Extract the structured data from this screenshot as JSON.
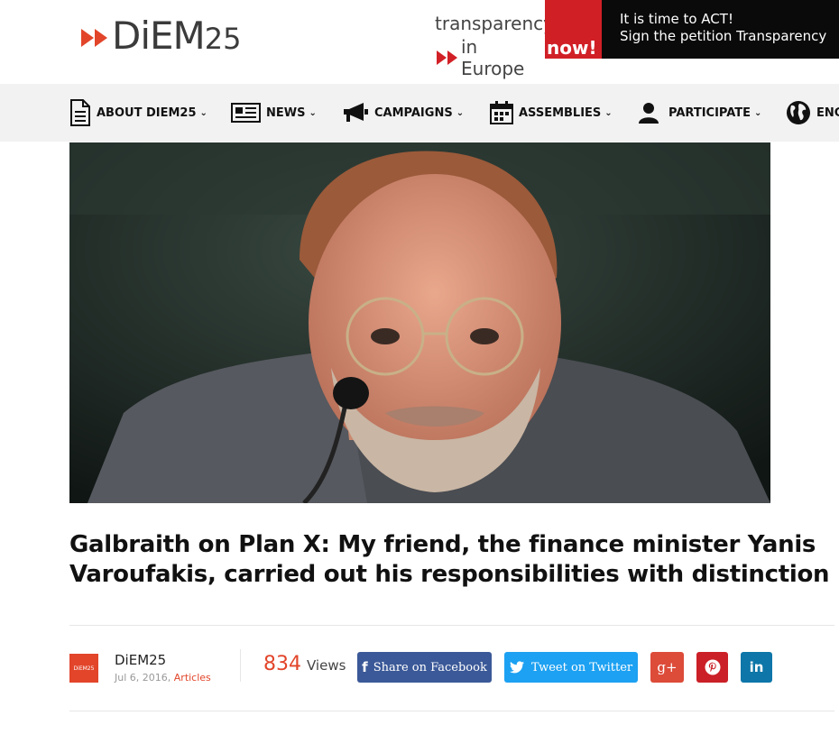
{
  "logo": {
    "main": "DiEM",
    "num": "25"
  },
  "banner": {
    "line1": "transparency",
    "line2": "in Europe",
    "now": "now!",
    "cta1": "It is time to ACT!",
    "cta2": "Sign the petition Transparency"
  },
  "nav": {
    "about": "ABOUT DIEM25",
    "news": "NEWS",
    "campaigns": "CAMPAIGNS",
    "assemblies": "ASSEMBLIES",
    "participate": "PARTICIPATE",
    "lang": "ENG",
    "chevron": "⌄"
  },
  "article": {
    "title_line1": "Galbraith on Plan X: My friend, the finance minister Yanis",
    "title_line2": "Varoufakis, carried out his responsibilities with distinction",
    "author": "DiEM25",
    "avatar_text": "DiEM25",
    "date": "Jul 6, 2016",
    "date_sep": ",",
    "category": "Articles",
    "views_count": "834",
    "views_label": "Views"
  },
  "share": {
    "facebook": "Share on Facebook",
    "twitter": "Tweet on Twitter",
    "google_icon": "g+",
    "pinterest_icon": "pinterest-icon",
    "linkedin_icon": "in"
  },
  "colors": {
    "accent": "#e2452a",
    "facebook": "#3b5998",
    "twitter": "#1da1f2",
    "google": "#dd4b39",
    "pinterest": "#cb2027",
    "linkedin": "#0e76a8",
    "nav_bg": "#f2f2f2"
  }
}
